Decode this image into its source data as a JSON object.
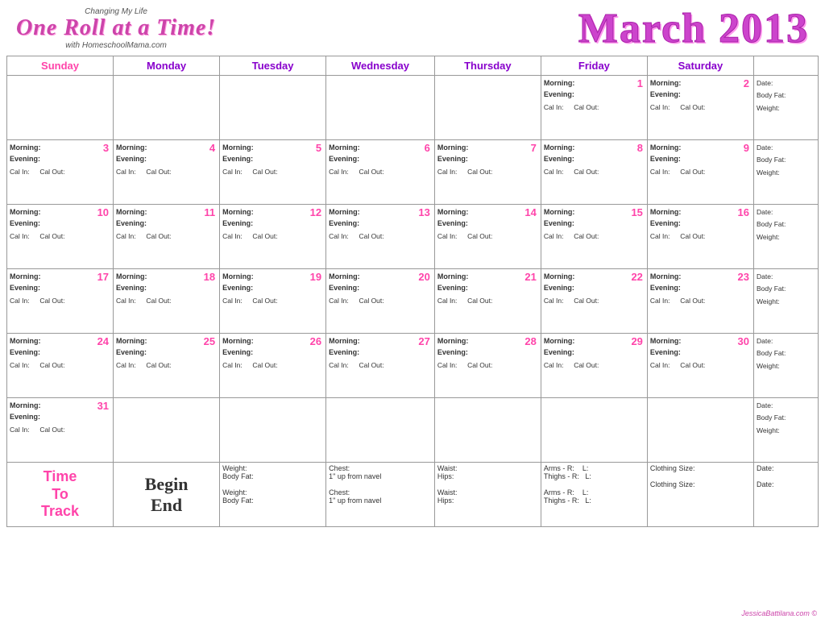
{
  "header": {
    "changing_text": "Changing My Life",
    "logo_title": "One Roll at a Time!",
    "logo_with": "with HomeschoolMama.com",
    "month_title": "March 2013"
  },
  "days_of_week": [
    {
      "label": "Sunday",
      "class": "sun"
    },
    {
      "label": "Monday",
      "class": "mon"
    },
    {
      "label": "Tuesday",
      "class": "tue"
    },
    {
      "label": "Wednesday",
      "class": "wed"
    },
    {
      "label": "Thursday",
      "class": "thu"
    },
    {
      "label": "Friday",
      "class": "fri"
    },
    {
      "label": "Saturday",
      "class": "sat"
    },
    {
      "label": "",
      "class": "extra"
    }
  ],
  "footer": "JessicaBattilana.com ©",
  "track": {
    "label": "Time\nTo\nTrack",
    "begin": "Begin",
    "end": "End"
  },
  "side_labels": {
    "date": "Date:",
    "body_fat": "Body Fat:",
    "weight": "Weight:"
  }
}
